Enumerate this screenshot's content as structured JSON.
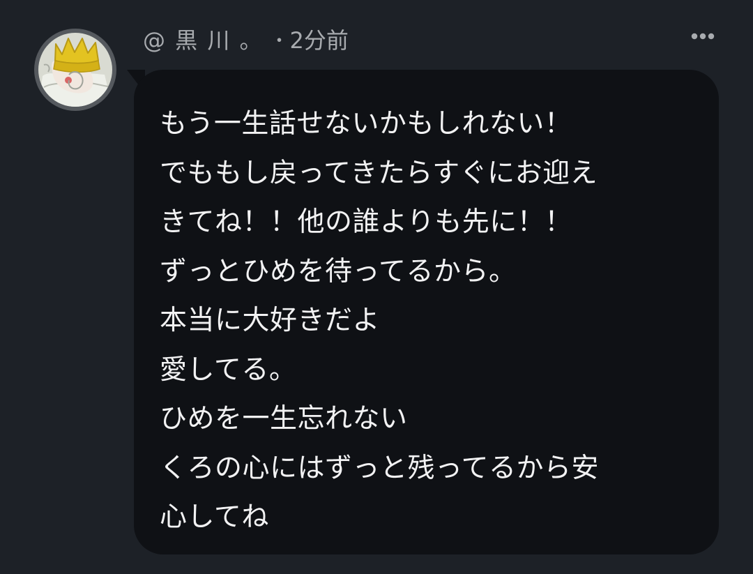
{
  "comment": {
    "avatar": {
      "icon": "profile-avatar-icon"
    },
    "author": "@ 黒 川 。",
    "separator": "・",
    "timestamp": "2分前",
    "more_icon": "more-options-icon",
    "message_lines": [
      "もう一生話せないかもしれない！",
      "でももし戻ってきたらすぐにお迎え",
      "きてね！！他の誰よりも先に！！",
      "ずっとひめを待ってるから。",
      "本当に大好きだよ",
      "愛してる。",
      "ひめを一生忘れない",
      "くろの心にはずっと残ってるから安",
      "心してね"
    ]
  },
  "colors": {
    "background": "#1d2127",
    "bubble": "#0f1115",
    "meta_text": "#a8abaf",
    "message_text": "#f2f2f3",
    "avatar_ring": "#55595e"
  }
}
